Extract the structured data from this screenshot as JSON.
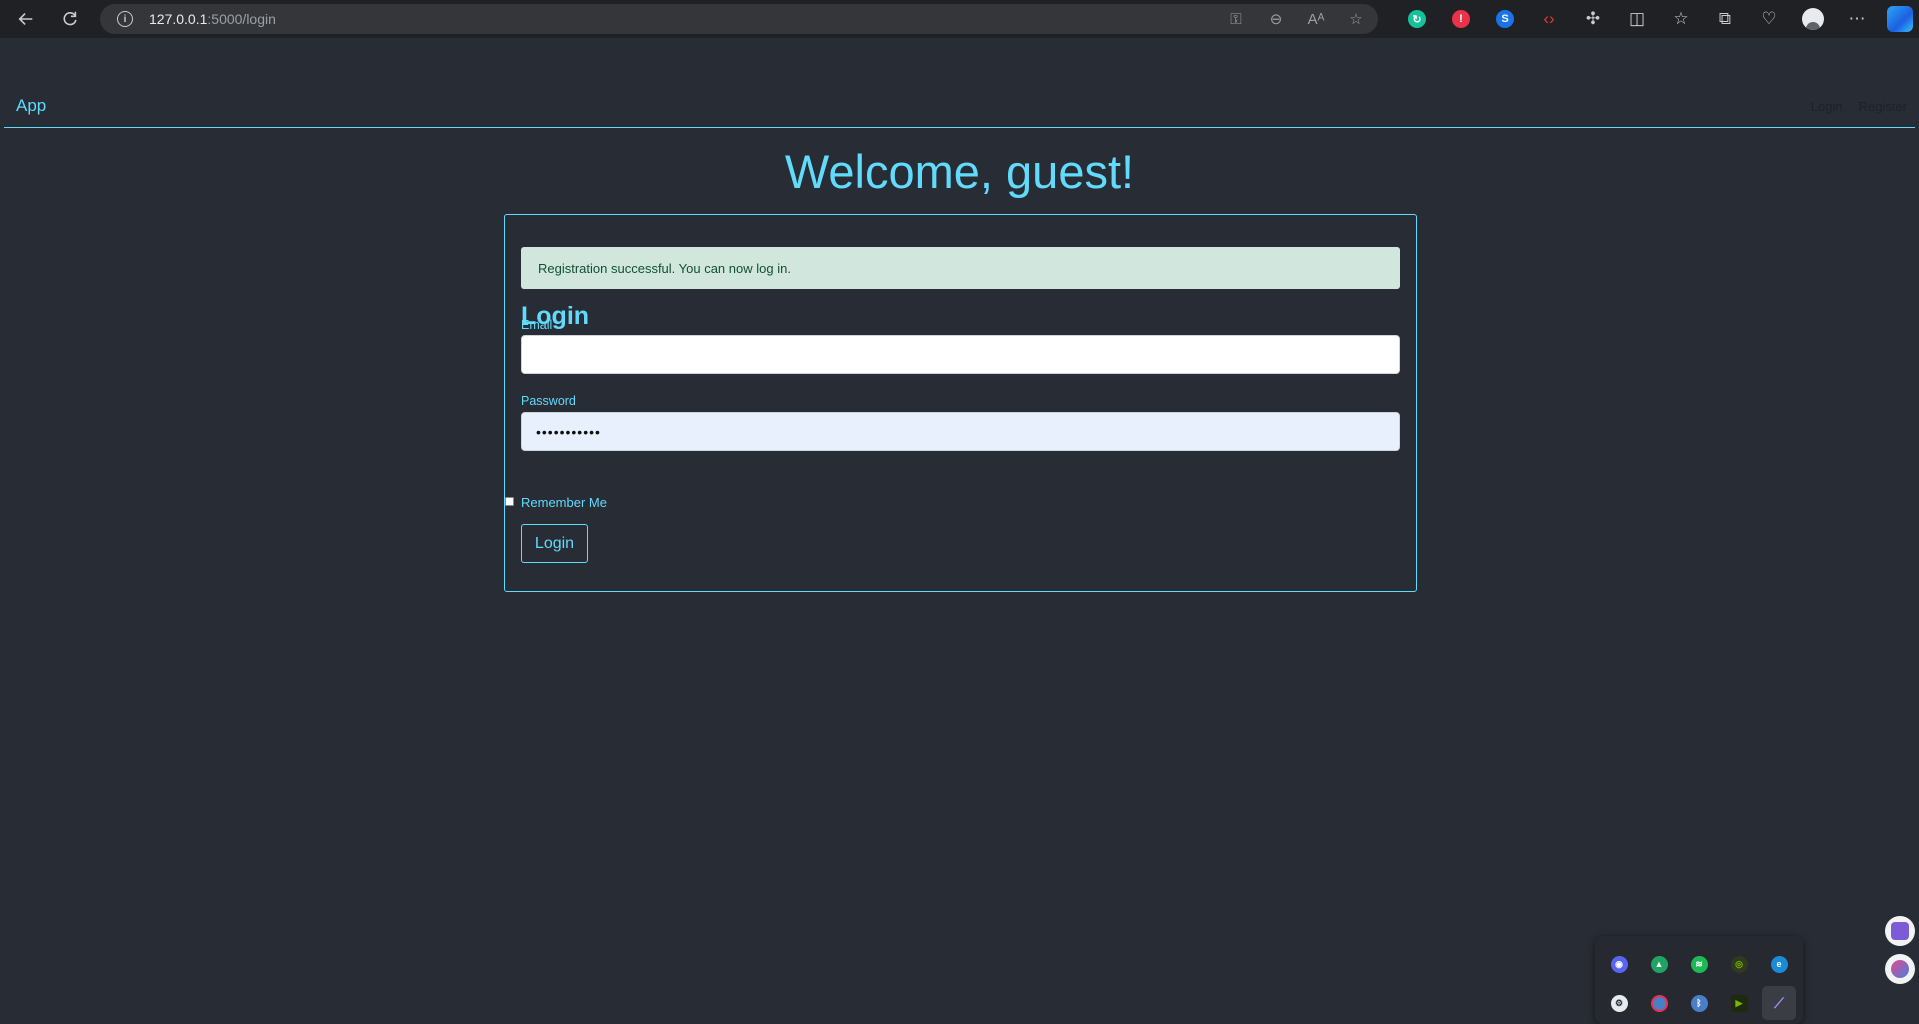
{
  "browser": {
    "url_host": "127.0.0.1",
    "url_path": ":5000/login",
    "address_icons": [
      "key-icon",
      "zoom-out-icon",
      "read-aloud-icon",
      "favorite-star-icon"
    ],
    "extensions": [
      {
        "name": "grammarly-extension-icon",
        "color": "#15c39a",
        "glyph": "G"
      },
      {
        "name": "extension-badge-icon",
        "color": "#e8334a",
        "glyph": "1"
      },
      {
        "name": "shazam-extension-icon",
        "color": "#1a73e8",
        "glyph": "S"
      },
      {
        "name": "dev-tools-extension-icon",
        "color": "#e53935",
        "glyph": "<>"
      }
    ]
  },
  "navbar": {
    "brand": "App",
    "links": [
      "Login",
      "Register"
    ]
  },
  "main": {
    "heading": "Welcome, guest!"
  },
  "login_card": {
    "alert": "Registration successful. You can now log in.",
    "title": "Login",
    "email_label": "Email",
    "email_value": "",
    "password_label": "Password",
    "password_value": "•••••••••••",
    "remember_label": "Remember Me",
    "remember_checked": false,
    "submit_label": "Login"
  },
  "colors": {
    "accent": "#61dafb",
    "background": "#282c34",
    "alert_bg": "#d1e7dd",
    "alert_text": "#0f5132"
  },
  "tray": {
    "icons": [
      {
        "name": "discord-icon",
        "color": "#5865f2"
      },
      {
        "name": "google-drive-icon",
        "color": "#1fa463"
      },
      {
        "name": "spotify-icon",
        "color": "#1db954"
      },
      {
        "name": "nvidia-icon",
        "color": "#76b900"
      },
      {
        "name": "edge-icon",
        "color": "#1a8bd8"
      },
      {
        "name": "steam-icon",
        "color": "#1b2838"
      },
      {
        "name": "app-red-icon",
        "color": "#e8334a"
      },
      {
        "name": "bluetooth-icon",
        "color": "#4a7ec9"
      },
      {
        "name": "nvidia-share-icon",
        "color": "#76b900"
      },
      {
        "name": "pen-icon",
        "color": "#b388ff"
      }
    ]
  }
}
